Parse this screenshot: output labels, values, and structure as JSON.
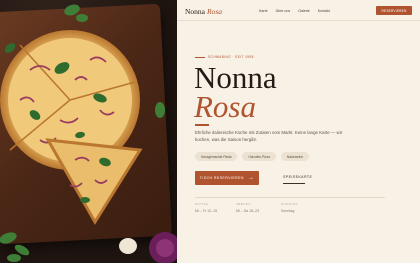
{
  "brand": {
    "name": "Nonna",
    "accent": "Rosa"
  },
  "nav": {
    "items": [
      "Karte",
      "Über uns",
      "Galerie",
      "Kontakt"
    ]
  },
  "header": {
    "reserve_label": "RESERVIEREN"
  },
  "hero": {
    "eyebrow": "SCHWABING · SEIT 1998",
    "title_line1": "Nonna",
    "title_line2": "Rosa",
    "description": "Ehrliche italienische Küche mit Zutaten vom Markt. Keine lange Karte — wir kochen, was die Saison hergibt.",
    "tags": [
      "Hausgemachte Pasta",
      "Holzofen-Pizza",
      "Naturweine"
    ],
    "cta_primary": "TISCH RESERVIEREN",
    "cta_arrow": "→",
    "cta_secondary": "SPEISEKARTE"
  },
  "info": [
    {
      "label": "MITTAG",
      "value": "Mi – Fr 12–15"
    },
    {
      "label": "ABENDS",
      "value": "Mi – Sa 18–23"
    },
    {
      "label": "RUHETAG",
      "value": "Sonntag"
    }
  ],
  "colors": {
    "accent": "#b0532f",
    "background": "#f8f1e6",
    "text": "#241b16"
  }
}
